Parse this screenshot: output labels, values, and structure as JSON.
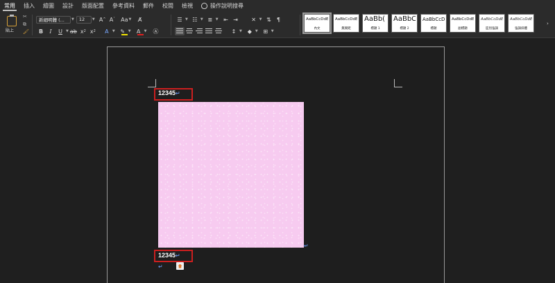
{
  "menu": {
    "tabs": [
      "常用",
      "插入",
      "繪圖",
      "設計",
      "版面配置",
      "參考資料",
      "郵件",
      "校閱",
      "檢視"
    ],
    "tell_me": "操作說明搜尋"
  },
  "ribbon": {
    "paste_label": "貼上",
    "font_name": "新細明體 (...",
    "font_size": "12",
    "aa_label": "Aa",
    "styles": [
      {
        "sample": "AaBbCcDdEe",
        "name": "內文"
      },
      {
        "sample": "AaBbCcDdEe",
        "name": "無間距"
      },
      {
        "sample": "AaBb(",
        "name": "標題 1"
      },
      {
        "sample": "AaBbC",
        "name": "標題 2"
      },
      {
        "sample": "AaBbCcD",
        "name": "標題"
      },
      {
        "sample": "AaBbCcDdEe",
        "name": "副標題"
      },
      {
        "sample": "AaBbCcDdEe",
        "name": "區別強調"
      },
      {
        "sample": "AaBbCcDdEe",
        "name": "強調斜體"
      }
    ]
  },
  "document": {
    "line1": "12345",
    "line2": "12345",
    "paragraph_mark": "↵",
    "image_fill": "#f7cbf0",
    "highlight_color": "#cc1f1f"
  }
}
